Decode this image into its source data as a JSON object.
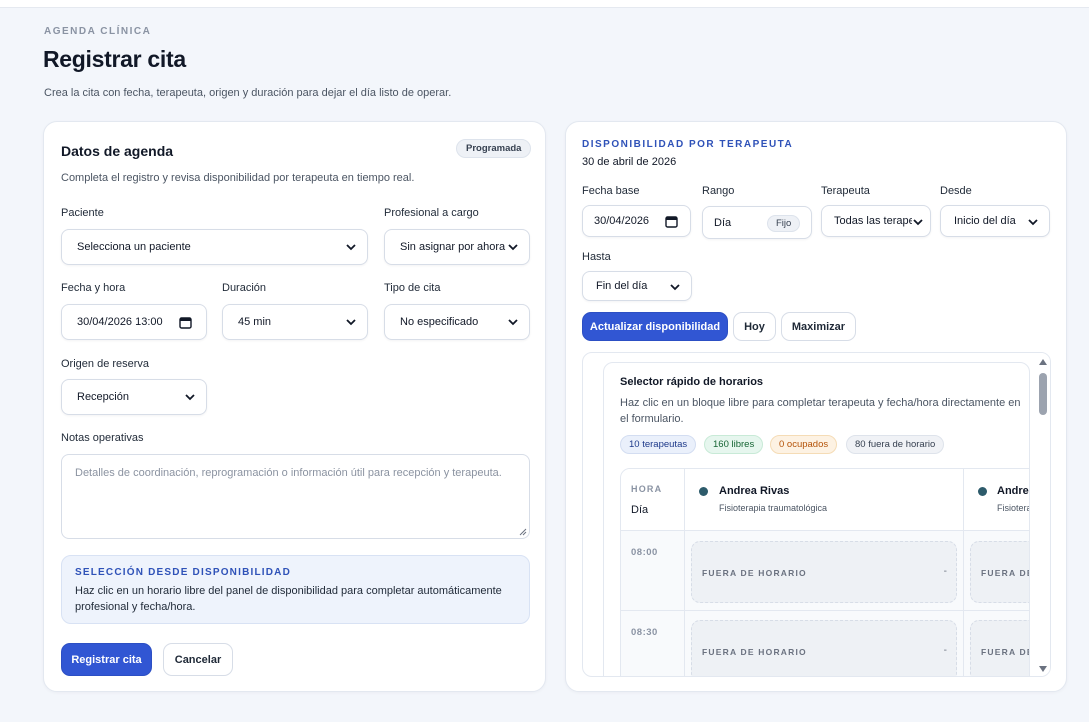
{
  "header": {
    "eyebrow": "AGENDA CLÍNICA",
    "title": "Registrar cita",
    "subtitle": "Crea la cita con fecha, terapeuta, origen y duración para dejar el día listo de operar."
  },
  "form": {
    "title": "Datos de agenda",
    "status_badge": "Programada",
    "description": "Completa el registro y revisa disponibilidad por terapeuta en tiempo real.",
    "paciente": {
      "label": "Paciente",
      "value": "Selecciona un paciente"
    },
    "profesional": {
      "label": "Profesional a cargo",
      "value": "Sin asignar por ahora"
    },
    "fecha_hora": {
      "label": "Fecha y hora",
      "value": "30/04/2026 13:00"
    },
    "duracion": {
      "label": "Duración",
      "value": "45 min"
    },
    "tipo_cita": {
      "label": "Tipo de cita",
      "value": "No especificado"
    },
    "origen": {
      "label": "Origen de reserva",
      "value": "Recepción"
    },
    "notas": {
      "label": "Notas operativas",
      "placeholder": "Detalles de coordinación, reprogramación o información útil para recepción y terapeuta."
    },
    "seleccion": {
      "title": "SELECCIÓN DESDE DISPONIBILIDAD",
      "text": "Haz clic en un horario libre del panel de disponibilidad para completar automáticamente profesional y fecha/hora."
    },
    "submit_label": "Registrar cita",
    "cancel_label": "Cancelar"
  },
  "availability": {
    "eyebrow": "DISPONIBILIDAD POR TERAPEUTA",
    "date": "30 de abril de 2026",
    "fecha_base": {
      "label": "Fecha base",
      "value": "30/04/2026"
    },
    "rango": {
      "label": "Rango",
      "value": "Día",
      "tag": "Fijo"
    },
    "terapeuta": {
      "label": "Terapeuta",
      "value": "Todas las terapeu"
    },
    "desde": {
      "label": "Desde",
      "value": "Inicio del día"
    },
    "hasta": {
      "label": "Hasta",
      "value": "Fin del día"
    },
    "refresh_label": "Actualizar disponibilidad",
    "today_label": "Hoy",
    "maximize_label": "Maximizar",
    "selector": {
      "title": "Selector rápido de horarios",
      "description": "Haz clic en un bloque libre para completar terapeuta y fecha/hora directamente en el formulario.",
      "chips": [
        "10 terapeutas",
        "160 libres",
        "0 ocupados",
        "80 fuera de horario"
      ],
      "hora_label": "HORA",
      "dia_label": "Día",
      "therapists": [
        {
          "name": "Andrea Rivas",
          "role": "Fisioterapia traumatológica"
        },
        {
          "name": "Andrea",
          "role": "Fisiotera"
        }
      ],
      "times": [
        "08:00",
        "08:30"
      ],
      "slot_label": "FUERA DE HORARIO",
      "slot_label_cut": "FUERA DE H",
      "slot_value": "-"
    }
  },
  "colors": {
    "primary": "#3156d3",
    "eyebrow_blue": "#2f52b8",
    "therapist_dot": "#2d5b6b"
  }
}
